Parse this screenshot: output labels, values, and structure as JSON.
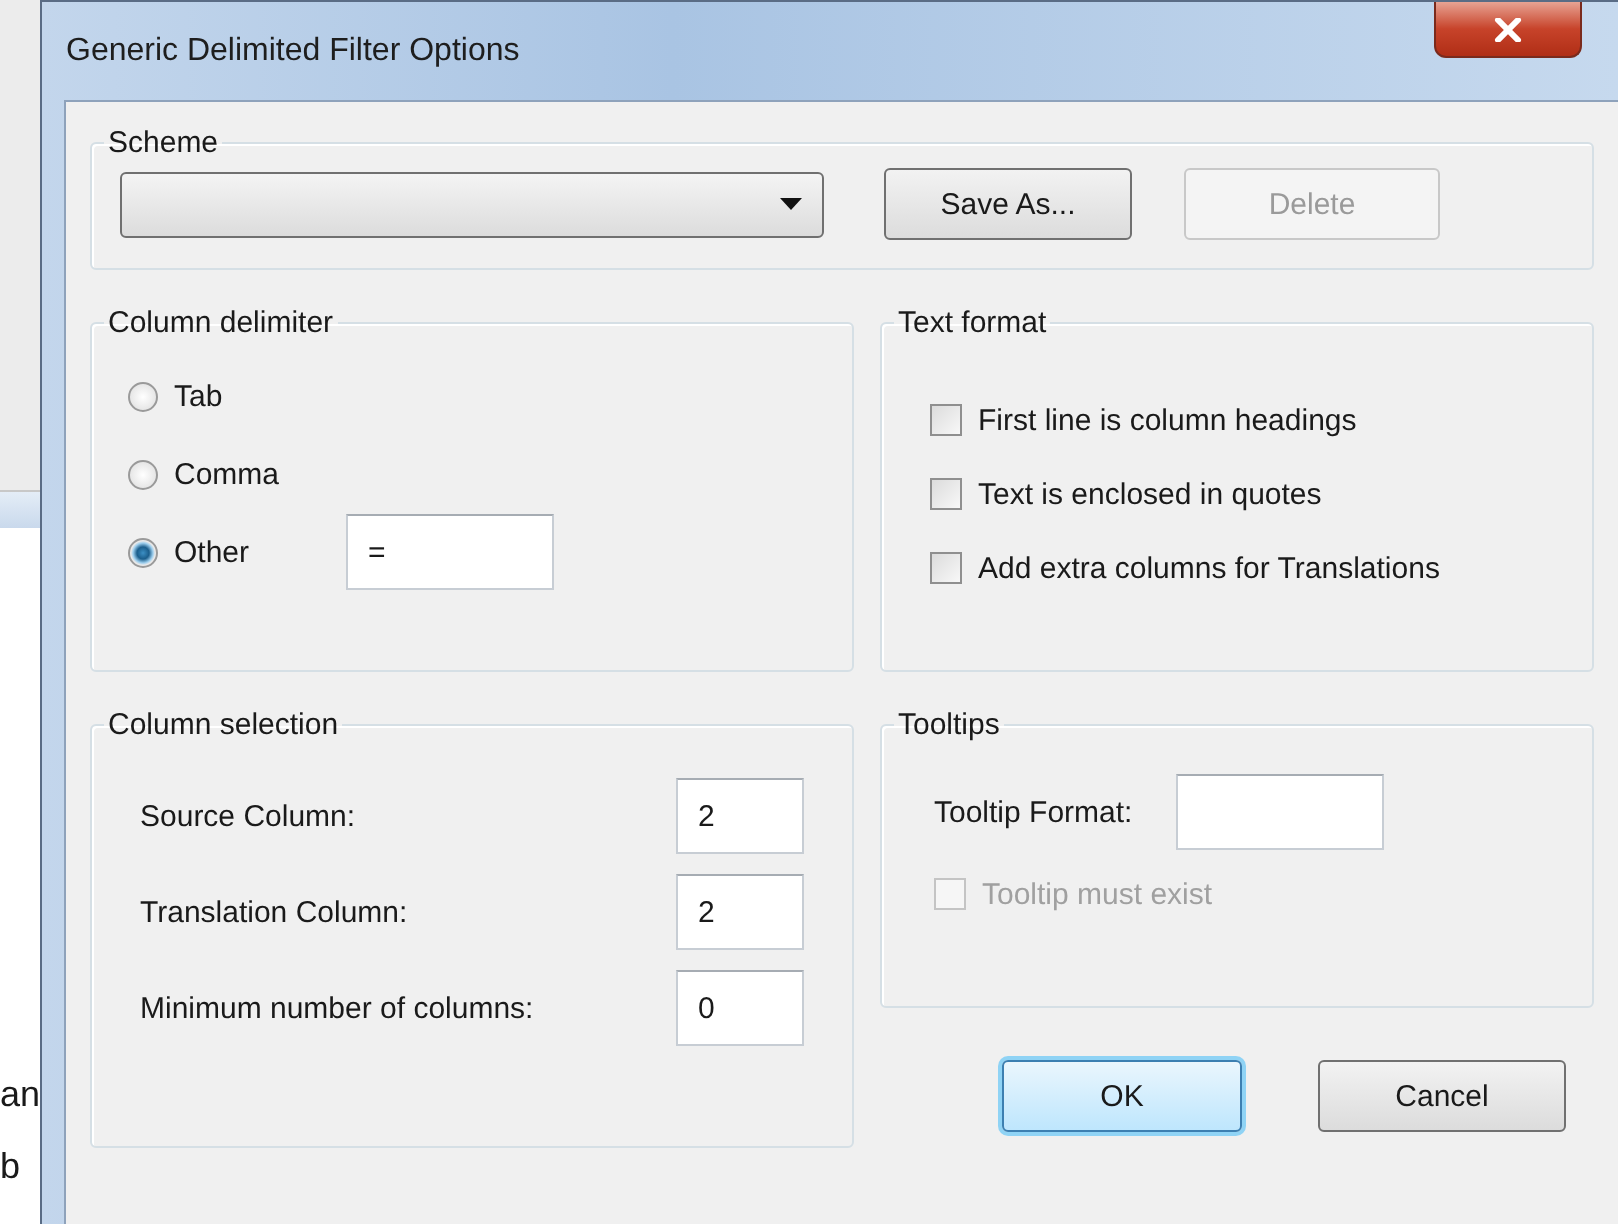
{
  "background_window": {
    "text_fragments": [
      "an",
      "b"
    ]
  },
  "window": {
    "title": "Generic Delimited Filter Options"
  },
  "scheme": {
    "title": "Scheme",
    "buttons": [
      {
        "label": "Save As...",
        "disabled": false
      },
      {
        "label": "Delete",
        "disabled": true
      }
    ]
  },
  "column_delimiter": {
    "title": "Column delimiter",
    "options": [
      {
        "label": "Tab",
        "selected": false
      },
      {
        "label": "Comma",
        "selected": false
      },
      {
        "label": "Other",
        "selected": true
      }
    ],
    "other_value": "="
  },
  "text_format": {
    "title": "Text format",
    "options": [
      {
        "label": "First line is column headings",
        "checked": false,
        "disabled": false
      },
      {
        "label": "Text is enclosed in quotes",
        "checked": false,
        "disabled": false
      },
      {
        "label": "Add extra columns for Translations",
        "checked": false,
        "disabled": false
      }
    ]
  },
  "column_selection": {
    "title": "Column selection",
    "fields": [
      {
        "label": "Source Column:",
        "value": "2"
      },
      {
        "label": "Translation Column:",
        "value": "2"
      },
      {
        "label": "Minimum number of columns:",
        "value": "0"
      }
    ]
  },
  "tooltips": {
    "title": "Tooltips",
    "format_label": "Tooltip Format:",
    "must_exist": {
      "label": "Tooltip must exist",
      "checked": false,
      "disabled": true
    }
  },
  "buttons": [
    {
      "label": "OK",
      "default": true
    },
    {
      "label": "Cancel",
      "default": false
    }
  ]
}
